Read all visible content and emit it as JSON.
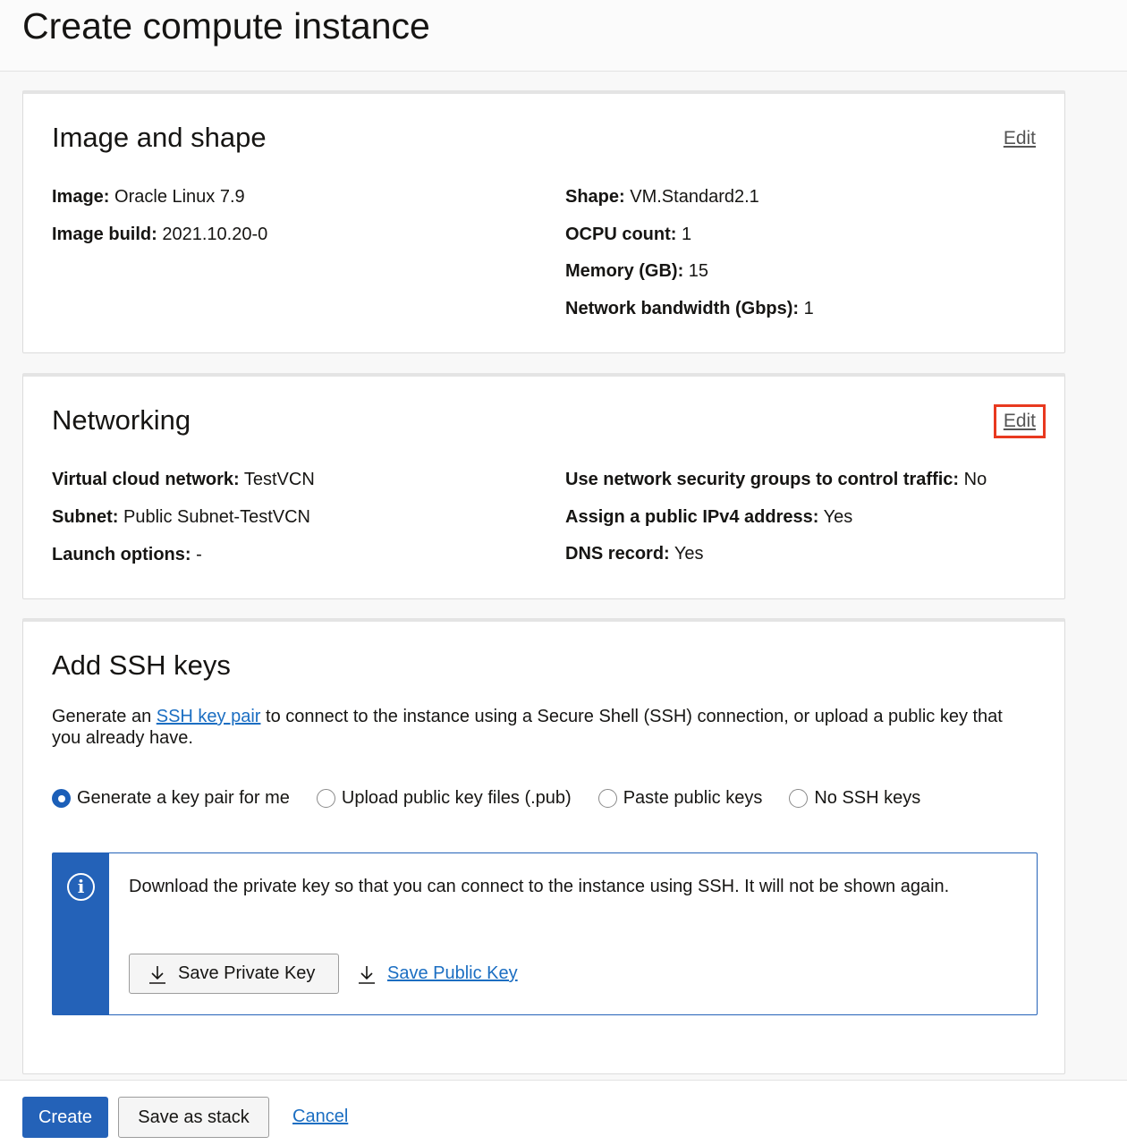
{
  "page": {
    "title": "Create compute instance"
  },
  "image_shape": {
    "title": "Image and shape",
    "edit_label": "Edit",
    "left": [
      {
        "key": "Image:",
        "value": "Oracle Linux 7.9"
      },
      {
        "key": "Image build:",
        "value": "2021.10.20-0"
      }
    ],
    "right": [
      {
        "key": "Shape:",
        "value": "VM.Standard2.1"
      },
      {
        "key": "OCPU count:",
        "value": "1"
      },
      {
        "key": "Memory (GB):",
        "value": "15"
      },
      {
        "key": "Network bandwidth (Gbps):",
        "value": "1"
      }
    ]
  },
  "networking": {
    "title": "Networking",
    "edit_label": "Edit",
    "left": [
      {
        "key": "Virtual cloud network:",
        "value": "TestVCN"
      },
      {
        "key": "Subnet:",
        "value": "Public Subnet-TestVCN"
      },
      {
        "key": "Launch options:",
        "value": "-"
      }
    ],
    "right": [
      {
        "key": "Use network security groups to control traffic:",
        "value": "No"
      },
      {
        "key": "Assign a public IPv4 address:",
        "value": "Yes"
      },
      {
        "key": "DNS record:",
        "value": "Yes"
      }
    ]
  },
  "ssh": {
    "title": "Add SSH keys",
    "desc_before": "Generate an ",
    "desc_link": "SSH key pair",
    "desc_after": " to connect to the instance using a Secure Shell (SSH) connection, or upload a public key that you already have.",
    "options": [
      {
        "label": "Generate a key pair for me",
        "checked": true
      },
      {
        "label": "Upload public key files (.pub)",
        "checked": false
      },
      {
        "label": "Paste public keys",
        "checked": false
      },
      {
        "label": "No SSH keys",
        "checked": false
      }
    ],
    "info_icon": "info-icon",
    "info_text": "Download the private key so that you can connect to the instance using SSH. It will not be shown again.",
    "save_private_label": "Save Private Key",
    "save_public_label": "Save Public Key",
    "download_icon": "download-icon"
  },
  "footer": {
    "create_label": "Create",
    "stack_label": "Save as stack",
    "cancel_label": "Cancel"
  },
  "colors": {
    "primary": "#2462b8",
    "link": "#1b6ec2",
    "highlight": "#e8391f"
  }
}
